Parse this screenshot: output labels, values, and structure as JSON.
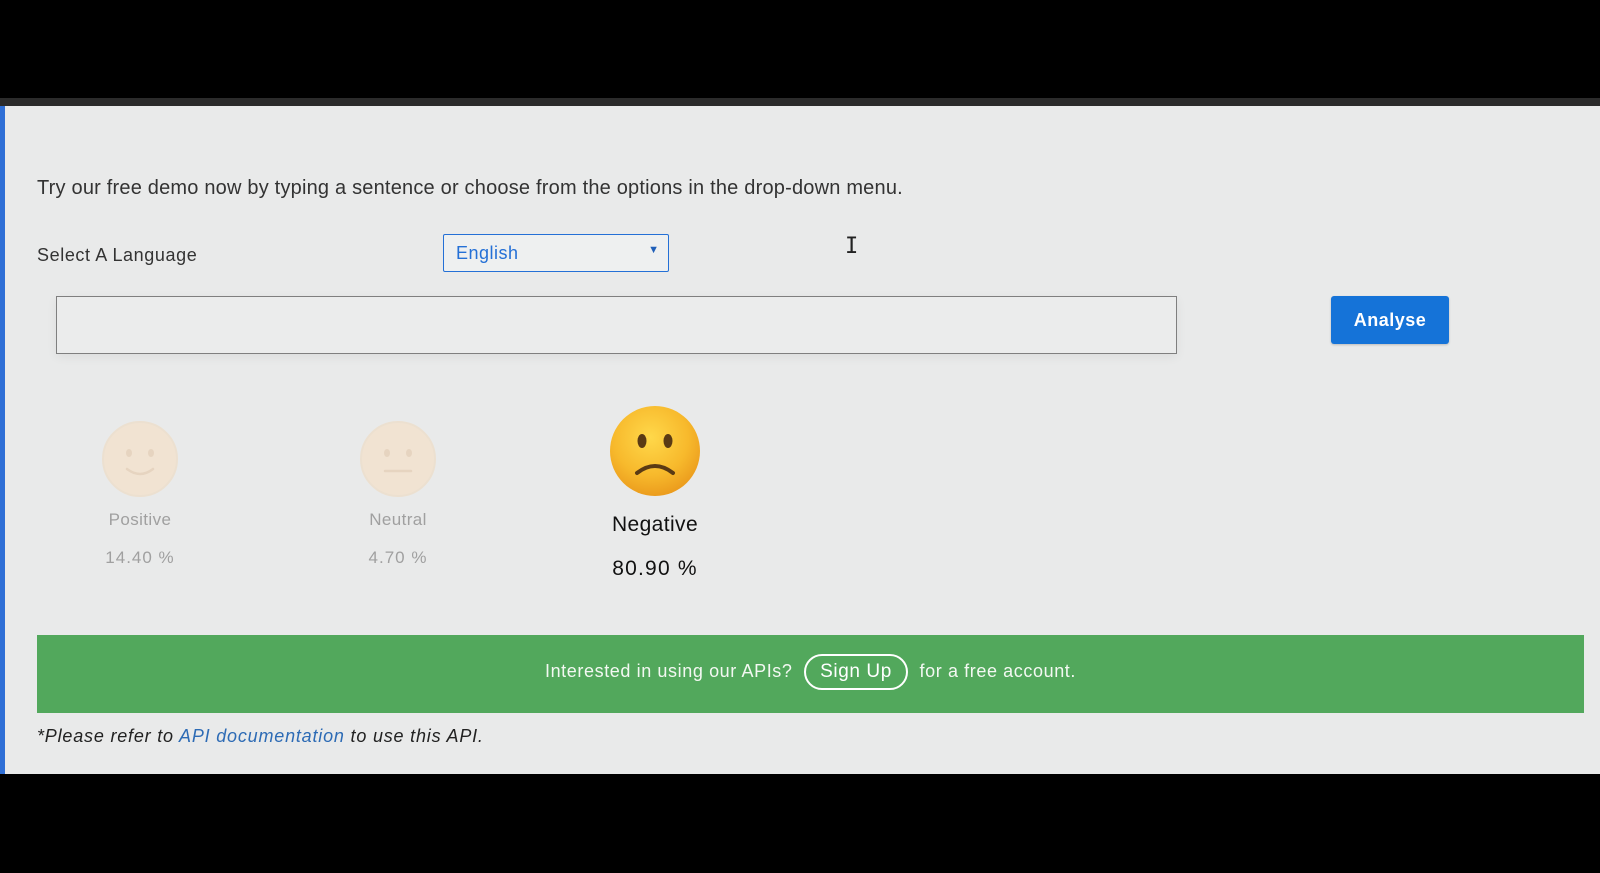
{
  "intro_text": "Try our free demo now by typing a sentence or choose from the options in the drop-down menu.",
  "language": {
    "label": "Select A Language",
    "selected": "English"
  },
  "input": {
    "value": "",
    "placeholder": ""
  },
  "analyse_button": "Analyse",
  "sentiments": {
    "positive": {
      "label": "Positive",
      "percent": "14.40 %",
      "icon": "smiling-face-icon"
    },
    "neutral": {
      "label": "Neutral",
      "percent": "4.70 %",
      "icon": "neutral-face-icon"
    },
    "negative": {
      "label": "Negative",
      "percent": "80.90 %",
      "icon": "frowning-face-icon"
    }
  },
  "banner": {
    "text_before": "Interested in using our APIs?",
    "signup_label": "Sign Up",
    "text_after": "for a free account.",
    "color": "#52a85c"
  },
  "footnote": {
    "prefix": "*Please refer to",
    "link_text": "API documentation",
    "suffix": "to use this API."
  },
  "colors": {
    "accent": "#1573d8",
    "page_background": "#e9eaea"
  }
}
